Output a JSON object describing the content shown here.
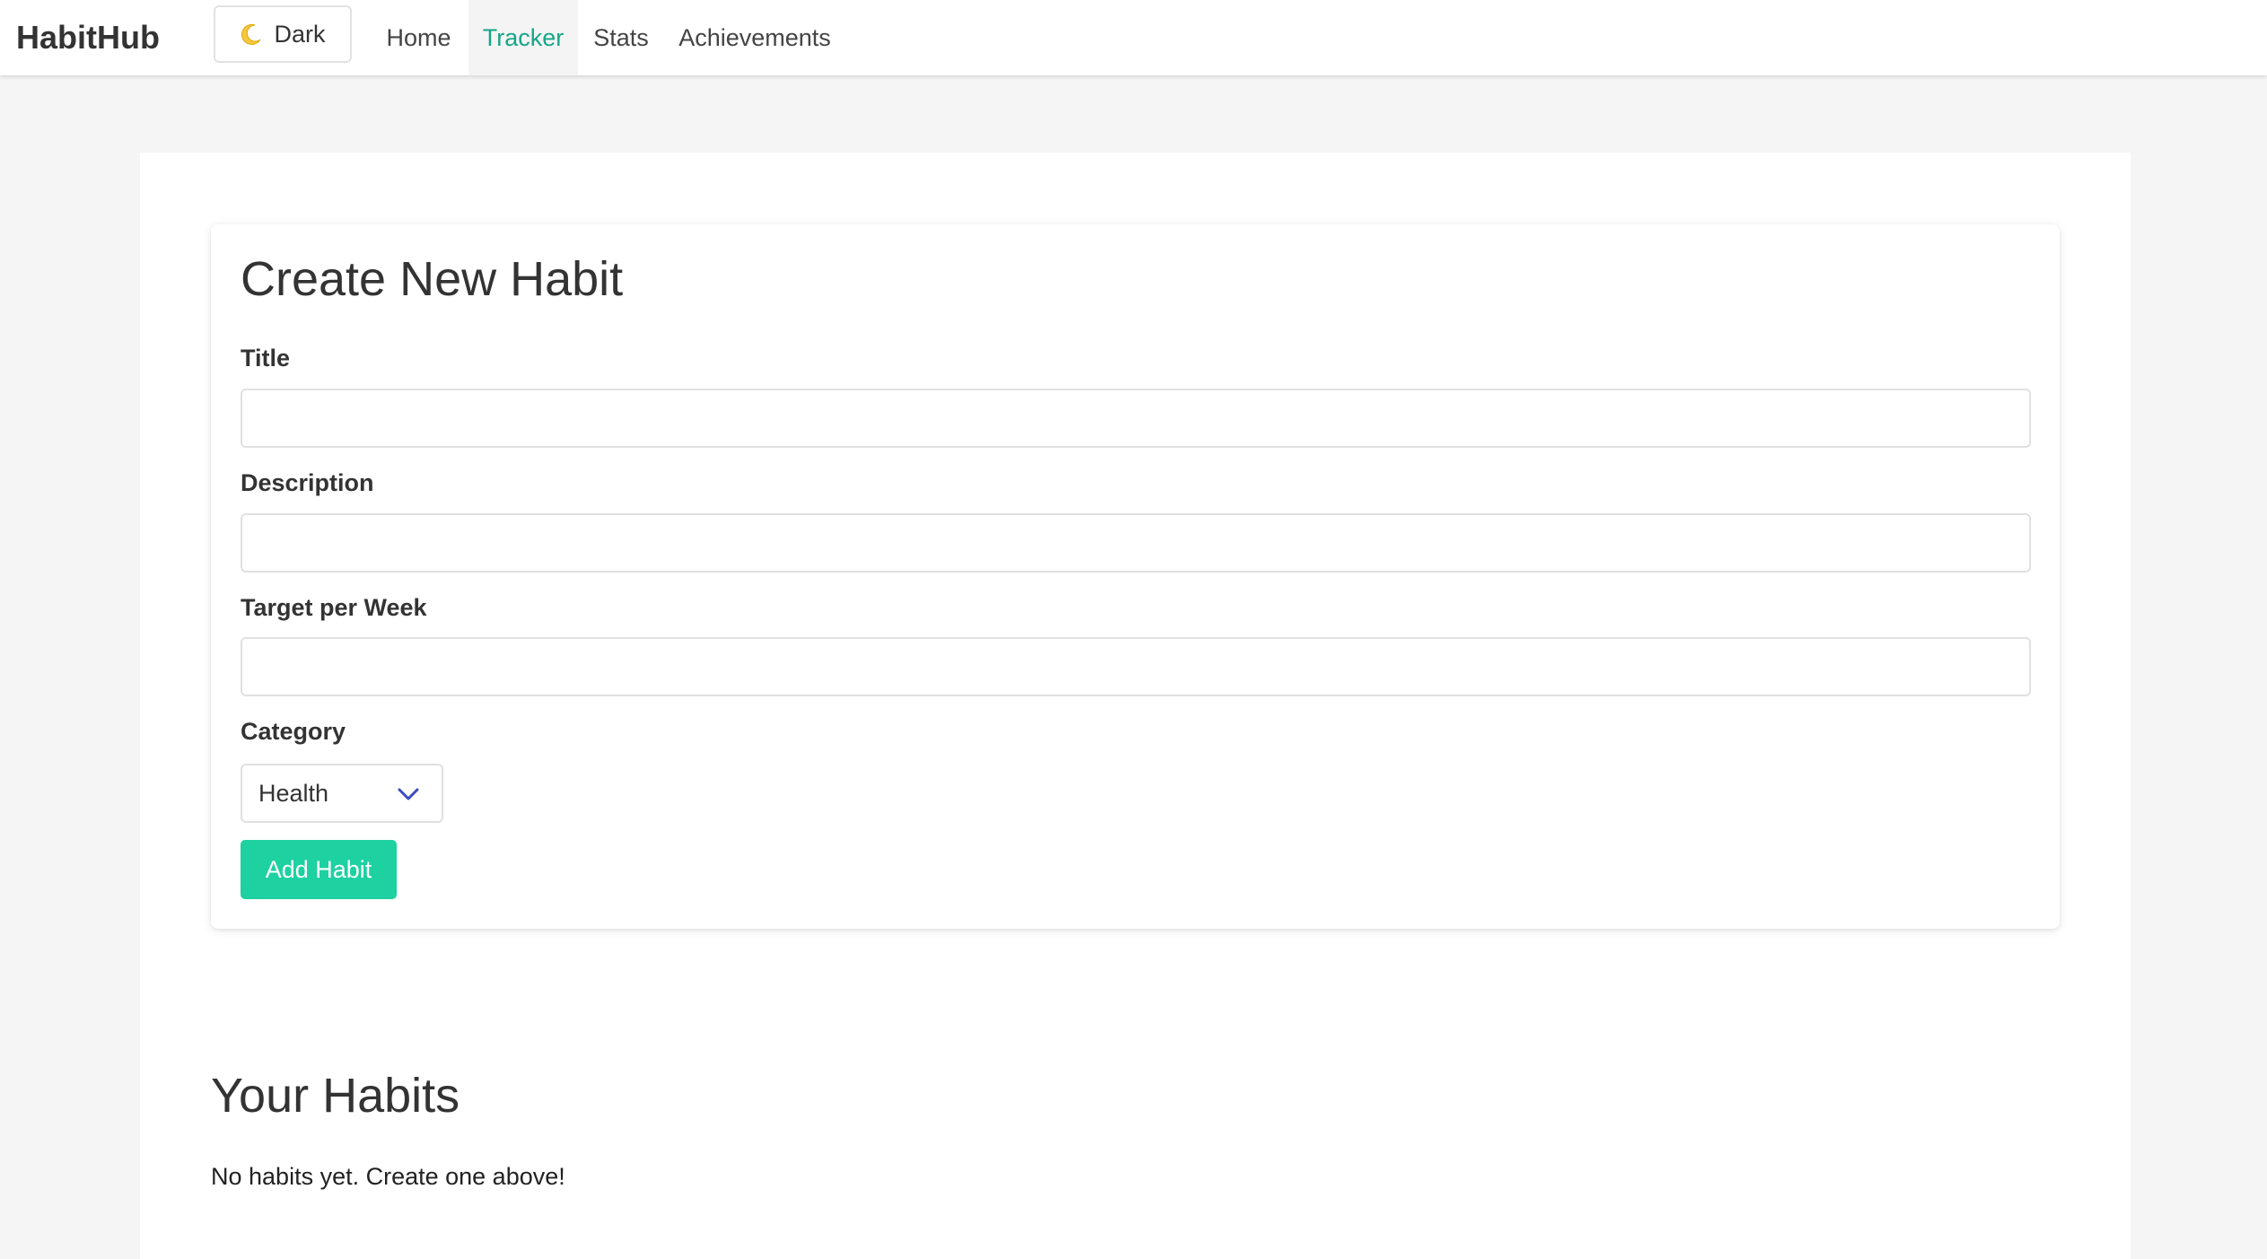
{
  "brand": "HabitHub",
  "theme_toggle": {
    "icon": "moon-icon",
    "label": "Dark"
  },
  "nav": {
    "items": [
      {
        "label": "Home",
        "active": false
      },
      {
        "label": "Tracker",
        "active": true
      },
      {
        "label": "Stats",
        "active": false
      },
      {
        "label": "Achievements",
        "active": false
      }
    ]
  },
  "form": {
    "title": "Create New Habit",
    "title_label": "Title",
    "title_value": "",
    "description_label": "Description",
    "description_value": "",
    "target_label": "Target per Week",
    "target_value": "",
    "category_label": "Category",
    "category_selected": "Health",
    "submit_label": "Add Habit"
  },
  "habits": {
    "title": "Your Habits",
    "empty_message": "No habits yet. Create one above!",
    "items": []
  },
  "colors": {
    "accent": "#1dd1a1",
    "active_nav": "#17a589",
    "chevron": "#3b4cc0"
  }
}
